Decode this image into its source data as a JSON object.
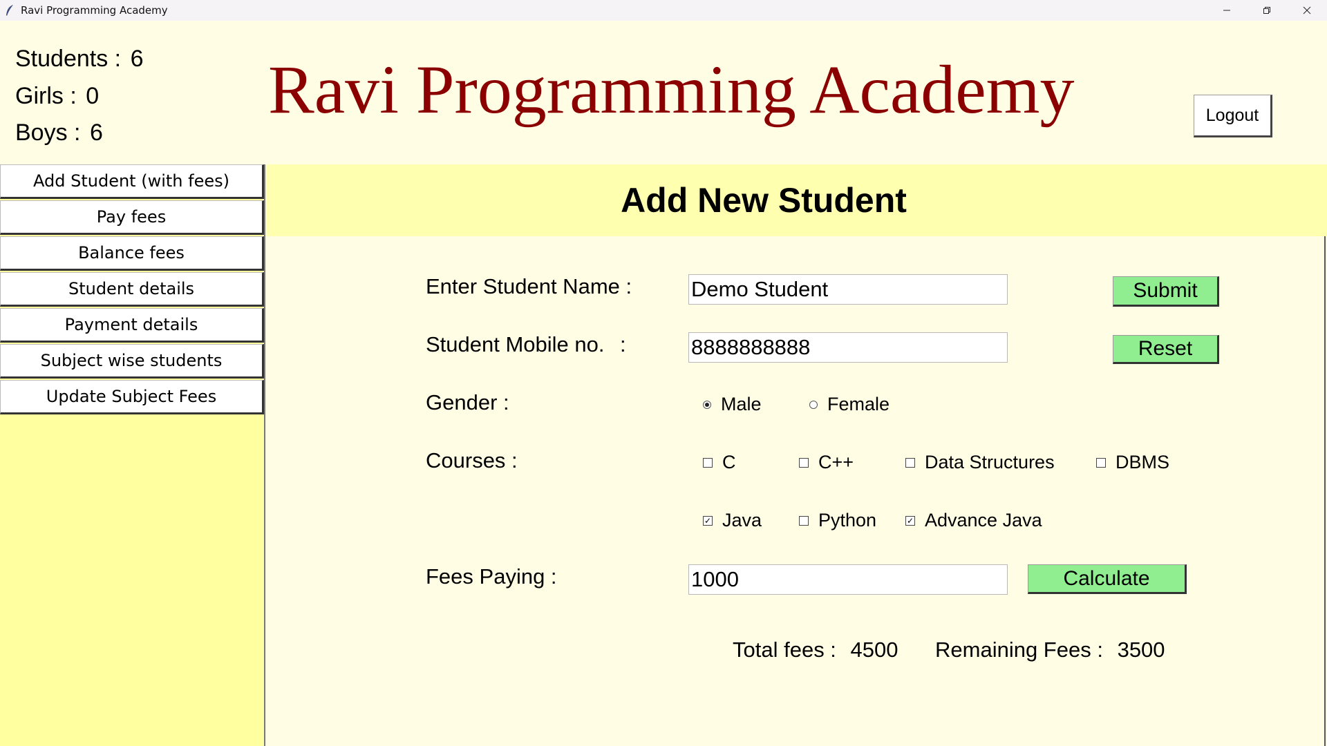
{
  "window": {
    "title": "Ravi Programming Academy"
  },
  "header": {
    "heading": "Ravi Programming Academy",
    "stats": [
      {
        "label": "Students :",
        "value": "6"
      },
      {
        "label": "Girls :",
        "value": "0"
      },
      {
        "label": "Boys :",
        "value": "6"
      }
    ],
    "logout_label": "Logout"
  },
  "sidebar": {
    "items": [
      {
        "label": "Add Student (with fees)"
      },
      {
        "label": "Pay fees"
      },
      {
        "label": "Balance fees"
      },
      {
        "label": "Student details"
      },
      {
        "label": "Payment details"
      },
      {
        "label": "Subject wise students"
      },
      {
        "label": "Update Subject Fees"
      }
    ]
  },
  "form": {
    "title": "Add New Student",
    "name_label": "Enter Student Name :",
    "name_value": "Demo Student",
    "mobile_label": "Student Mobile no.",
    "mobile_colon": ":",
    "mobile_value": "8888888888",
    "gender_label": "Gender :",
    "gender_options": [
      {
        "label": "Male",
        "selected": true
      },
      {
        "label": "Female",
        "selected": false
      }
    ],
    "courses_label": "Courses :",
    "courses": [
      {
        "label": "C",
        "checked": false
      },
      {
        "label": "C++",
        "checked": false
      },
      {
        "label": "Data Structures",
        "checked": false
      },
      {
        "label": "DBMS",
        "checked": false
      },
      {
        "label": "Java",
        "checked": true
      },
      {
        "label": "Python",
        "checked": false
      },
      {
        "label": "Advance Java",
        "checked": true
      }
    ],
    "fees_label": "Fees Paying :",
    "fees_value": "1000",
    "submit_label": "Submit",
    "reset_label": "Reset",
    "calculate_label": "Calculate",
    "total_fees_label": "Total fees :",
    "total_fees_value": "4500",
    "remaining_fees_label": "Remaining Fees :",
    "remaining_fees_value": "3500"
  },
  "colors": {
    "heading": "#8b0000",
    "button_green": "#90ee90",
    "sidebar_bg": "#ffff9f",
    "page_bg": "#fffde4"
  }
}
